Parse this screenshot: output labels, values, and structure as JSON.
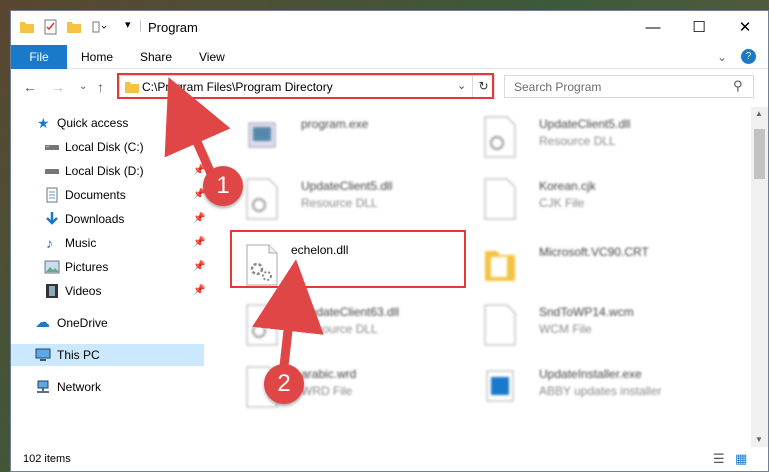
{
  "window": {
    "title": "Program",
    "controls": {
      "minimize": "—",
      "maximize": "☐",
      "close": "✕"
    }
  },
  "ribbon": {
    "tabs": [
      "File",
      "Home",
      "Share",
      "View"
    ],
    "help": "?"
  },
  "address": {
    "path": "C:\\Program Files\\Program Directory",
    "search_placeholder": "Search Program"
  },
  "nav": {
    "quick_access": "Quick access",
    "items": [
      {
        "label": "Local Disk (C:)",
        "icon": "drive-icon",
        "pinned": false
      },
      {
        "label": "Local Disk (D:)",
        "icon": "drive-icon",
        "pinned": true
      },
      {
        "label": "Documents",
        "icon": "documents-icon",
        "pinned": true
      },
      {
        "label": "Downloads",
        "icon": "downloads-icon",
        "pinned": true
      },
      {
        "label": "Music",
        "icon": "music-icon",
        "pinned": true
      },
      {
        "label": "Pictures",
        "icon": "pictures-icon",
        "pinned": true
      },
      {
        "label": "Videos",
        "icon": "videos-icon",
        "pinned": true
      }
    ],
    "onedrive": "OneDrive",
    "this_pc": "This PC",
    "network": "Network"
  },
  "files": [
    {
      "name": "program.exe",
      "type": ""
    },
    {
      "name": "UpdateClient5.dll",
      "type": "Resource DLL"
    },
    {
      "name": "UpdateClient5.dll",
      "type": "Resource DLL"
    },
    {
      "name": "Korean.cjk",
      "type": "CJK File"
    },
    {
      "name": "echelon.dll",
      "type": ""
    },
    {
      "name": "Microsoft.VC90.CRT",
      "type": ""
    },
    {
      "name": "UpdateClient63.dll",
      "type": "Resource DLL"
    },
    {
      "name": "SndToWP14.wcm",
      "type": "WCM File"
    },
    {
      "name": "arabic.wrd",
      "type": "WRD File"
    },
    {
      "name": "UpdateInstaller.exe",
      "type": "ABBY updates installer"
    }
  ],
  "status": {
    "count": "102 items"
  },
  "annotations": {
    "step1": "1",
    "step2": "2"
  },
  "colors": {
    "accent": "#1979ca",
    "highlight": "#e53935",
    "selected": "#cce8ff"
  }
}
